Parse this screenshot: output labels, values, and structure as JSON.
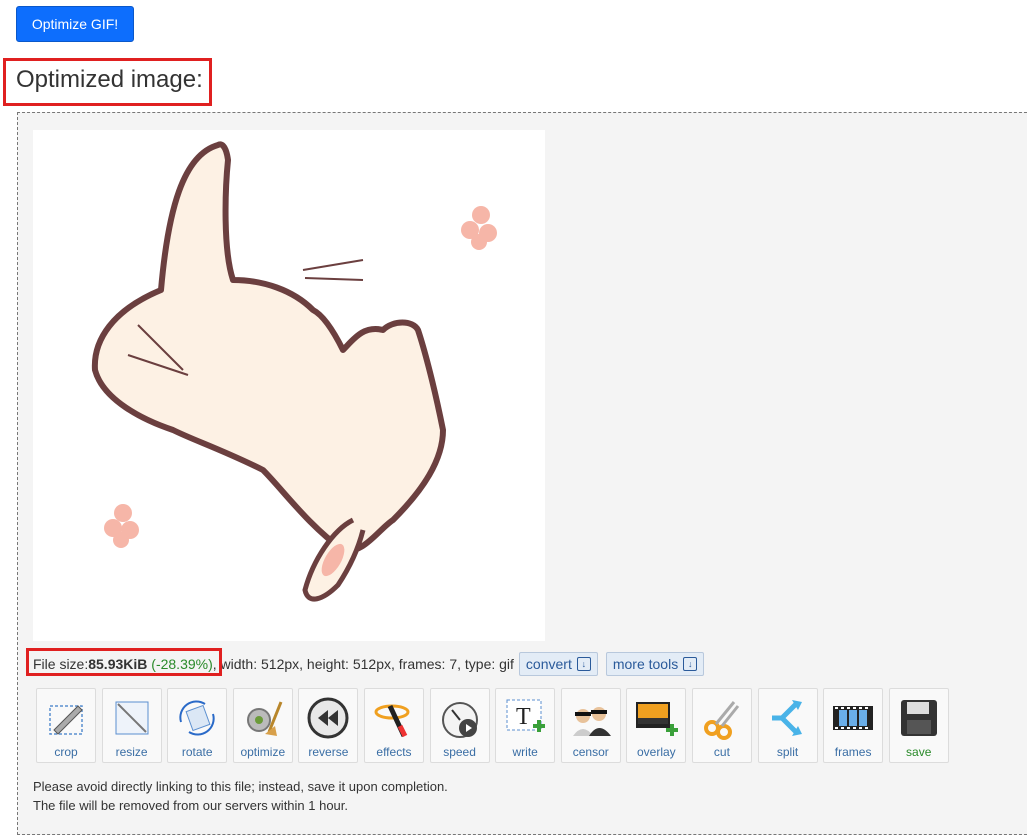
{
  "optimize_button": "Optimize GIF!",
  "heading": "Optimized image:",
  "file_info": {
    "label": "File size: ",
    "size": "85.93KiB",
    "reduction": "(-28.39%)",
    "details": ", width: 512px, height: 512px, frames: 7, type: gif"
  },
  "chips": {
    "convert": "convert",
    "more_tools": "more tools"
  },
  "tools": [
    {
      "label": "crop",
      "icon": "crop-icon"
    },
    {
      "label": "resize",
      "icon": "resize-icon"
    },
    {
      "label": "rotate",
      "icon": "rotate-icon"
    },
    {
      "label": "optimize",
      "icon": "optimize-icon"
    },
    {
      "label": "reverse",
      "icon": "reverse-icon"
    },
    {
      "label": "effects",
      "icon": "effects-icon"
    },
    {
      "label": "speed",
      "icon": "speed-icon"
    },
    {
      "label": "write",
      "icon": "write-icon"
    },
    {
      "label": "censor",
      "icon": "censor-icon"
    },
    {
      "label": "overlay",
      "icon": "overlay-icon"
    },
    {
      "label": "cut",
      "icon": "cut-icon"
    },
    {
      "label": "split",
      "icon": "split-icon"
    },
    {
      "label": "frames",
      "icon": "frames-icon"
    },
    {
      "label": "save",
      "icon": "save-icon"
    }
  ],
  "notice": {
    "line1": "Please avoid directly linking to this file; instead, save it upon completion.",
    "line2": "The file will be removed from our servers within 1 hour."
  },
  "colors": {
    "primary": "#0d6efd",
    "highlight": "#e02020",
    "success": "#2a8a2a",
    "link": "#3a6ea5"
  }
}
